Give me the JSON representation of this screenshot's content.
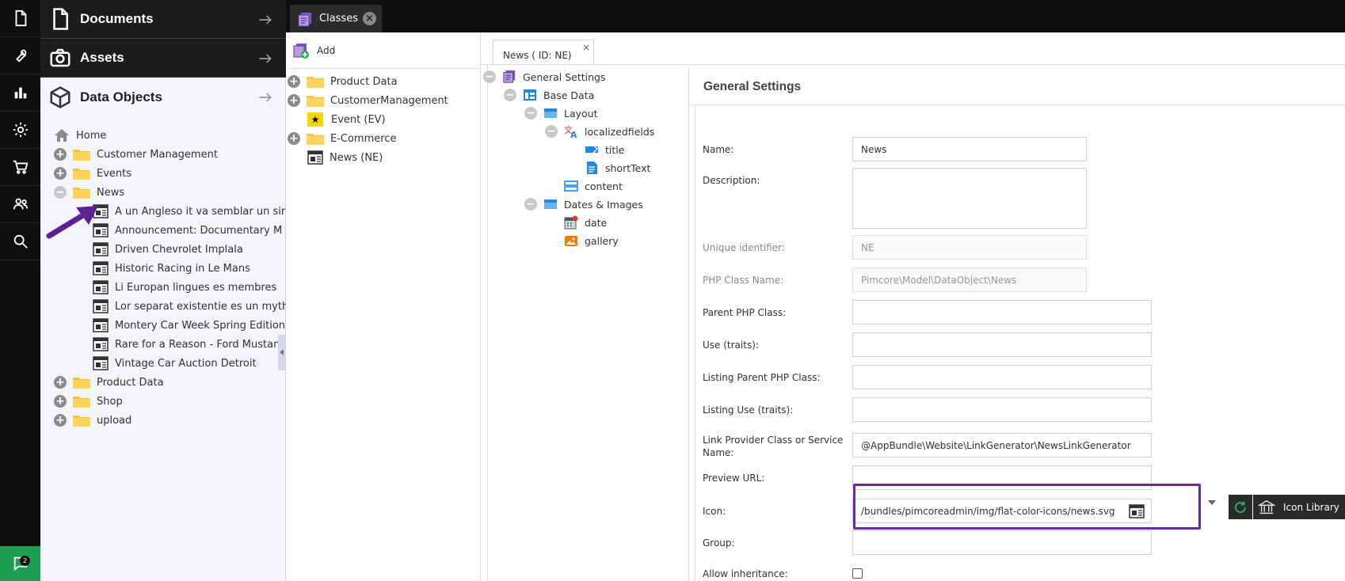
{
  "rail": {
    "items": [
      "documents-icon",
      "tools-icon",
      "reports-icon",
      "settings-icon",
      "ecommerce-icon",
      "users-icon",
      "search-icon"
    ],
    "chat_badge": "2"
  },
  "nav": {
    "documents": "Documents",
    "assets": "Assets",
    "data_objects": "Data Objects",
    "tree": {
      "home": "Home",
      "customer_management": "Customer Management",
      "events": "Events",
      "news": "News",
      "news_items": [
        "A un Angleso it va semblar un sir",
        "Announcement: Documentary M",
        "Driven Chevrolet Implala",
        "Historic Racing in Le Mans",
        "Li Europan lingues es membres",
        "Lor separat existentie es un myth",
        "Montery Car Week Spring Edition",
        "Rare for a Reason - Ford Mustang",
        "Vintage Car Auction Detroit"
      ],
      "product_data": "Product Data",
      "shop": "Shop",
      "upload": "upload"
    }
  },
  "tabs": {
    "classes": "Classes"
  },
  "classes_panel": {
    "add_label": "Add",
    "items": {
      "product_data": "Product Data",
      "customer_management": "CustomerManagement",
      "event": "Event (EV)",
      "ecommerce": "E-Commerce",
      "news": "News (NE)"
    }
  },
  "editor": {
    "tab_label": "News ( ID: NE)",
    "tab_close": "×",
    "layout_tree": {
      "general_settings": "General Settings",
      "base_data": "Base Data",
      "layout": "Layout",
      "localizedfields": "localizedfields",
      "title": "title",
      "short_text": "shortText",
      "content": "content",
      "dates_images": "Dates & Images",
      "date": "date",
      "gallery": "gallery"
    },
    "settings": {
      "title": "General Settings",
      "name_label": "Name:",
      "name_value": "News",
      "description_label": "Description:",
      "description_value": "",
      "unique_id_label": "Unique identifier:",
      "unique_id_value": "NE",
      "php_class_label": "PHP Class Name:",
      "php_class_value": "Pimcore\\Model\\DataObject\\News",
      "parent_php_label": "Parent PHP Class:",
      "parent_php_value": "",
      "traits_label": "Use (traits):",
      "traits_value": "",
      "listing_parent_label": "Listing Parent PHP Class:",
      "listing_parent_value": "",
      "listing_traits_label": "Listing Use (traits):",
      "listing_traits_value": "",
      "link_provider_label": "Link Provider Class or Service Name:",
      "link_provider_value": "@AppBundle\\Website\\LinkGenerator\\NewsLinkGenerator",
      "preview_url_label": "Preview URL:",
      "preview_url_value": "",
      "icon_label": "Icon:",
      "icon_value": "/bundles/pimcoreadmin/img/flat-color-icons/news.svg",
      "group_label": "Group:",
      "group_value": "",
      "allow_inheritance_label": "Allow inheritance:",
      "allow_inheritance": false,
      "icon_library_label": "Icon Library"
    }
  },
  "colors": {
    "accent_purple": "#6a2aa0",
    "refresh_green": "#23b567",
    "chat_green": "#1e9e52"
  }
}
